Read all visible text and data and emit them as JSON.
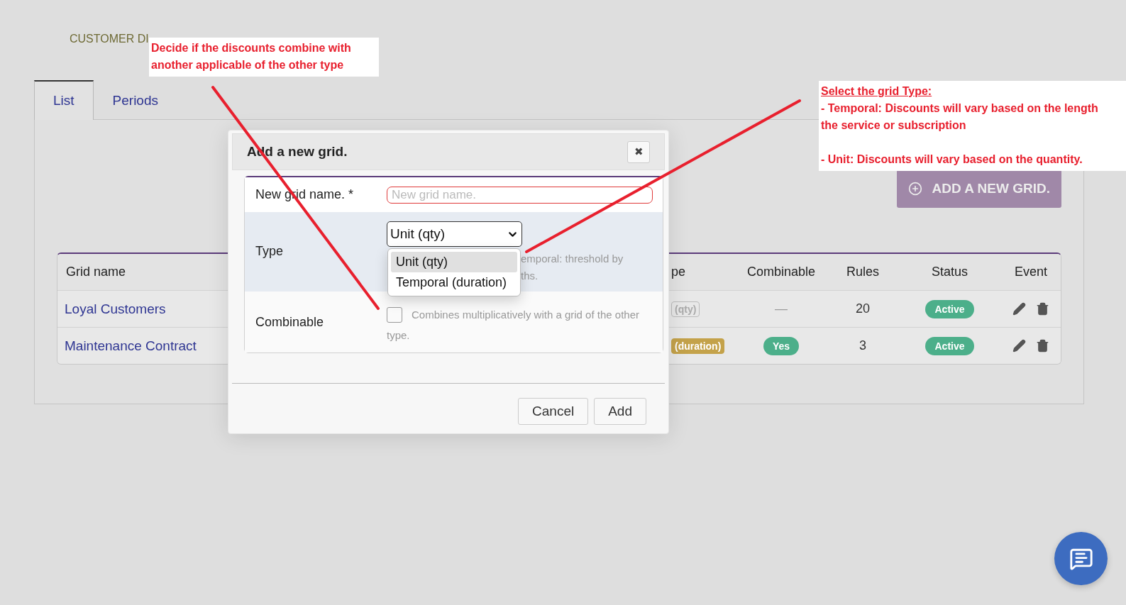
{
  "page_title": "CUSTOMER DI",
  "tabs": [
    {
      "label": "List",
      "selected": true
    },
    {
      "label": "Periods",
      "selected": false
    }
  ],
  "add_button": "ADD A NEW GRID.",
  "table": {
    "columns": [
      "Grid name",
      "pe",
      "Combinable",
      "Rules",
      "Status",
      "Event"
    ],
    "rows": [
      {
        "name": "Loyal Customers",
        "type": {
          "kind": "outline",
          "text": "(qty)"
        },
        "combinable": {
          "kind": "dash",
          "text": "—"
        },
        "rules": "20",
        "status": {
          "text": "Active",
          "color": "#4caf8a"
        }
      },
      {
        "name": "Maintenance Contract",
        "type": {
          "kind": "gold",
          "text": "(duration)"
        },
        "combinable": {
          "kind": "badge",
          "text": "Yes"
        },
        "rules": "3",
        "status": {
          "text": "Active",
          "color": "#4caf8a"
        }
      }
    ]
  },
  "dialog": {
    "title": "Add a new grid.",
    "close": "✖",
    "name_label": "New grid name. *",
    "name_placeholder": "New grid name.",
    "type_label": "Type",
    "type_value": "Unit (qty)",
    "type_options": [
      {
        "label": "Unit (qty)",
        "selected": true
      },
      {
        "label": "Temporal (duration)",
        "selected": false
      }
    ],
    "type_hint": [
      "emporal: threshold by",
      "ths."
    ],
    "combinable_label": "Combinable",
    "combinable_checked": false,
    "combinable_text": [
      "Combines multiplicatively with a grid of the other",
      "type."
    ],
    "buttons": [
      "Cancel",
      "Add"
    ]
  },
  "annotations": [
    {
      "paragraphs": [
        [
          "Decide if the discounts combine with",
          "another applicable of the other type"
        ]
      ]
    },
    {
      "heading": "Select the grid Type:",
      "paragraphs": [
        [
          "- Temporal: Discounts will vary based on the length",
          "the service or subscription"
        ],
        [
          "- Unit: Discounts will vary based on the quantity."
        ]
      ]
    }
  ]
}
